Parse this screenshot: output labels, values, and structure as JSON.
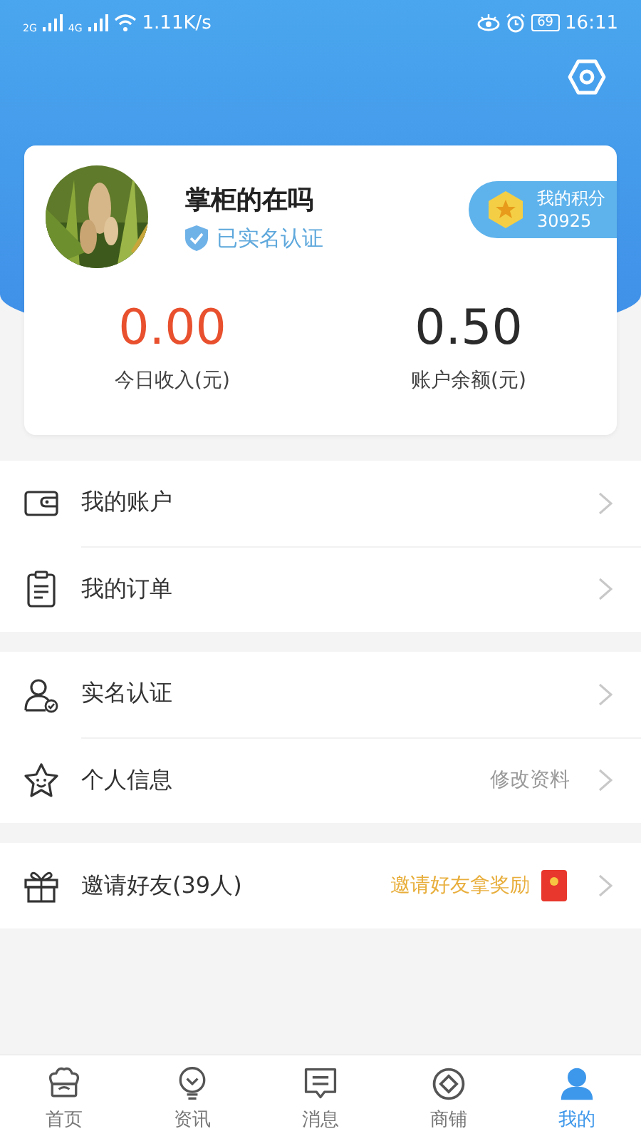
{
  "status_bar": {
    "network_1": "2G",
    "network_2": "4G",
    "speed": "1.11K/s",
    "battery": "69",
    "time": "16:11"
  },
  "profile": {
    "name": "掌柜的在吗",
    "verified": "已实名认证",
    "points_label": "我的积分",
    "points": "30925"
  },
  "stats": [
    {
      "value": "0.00",
      "label": "今日收入(元)",
      "kind": "income"
    },
    {
      "value": "0.50",
      "label": "账户余额(元)",
      "kind": "balance"
    }
  ],
  "menu_groups": [
    [
      {
        "label": "我的账户",
        "kind": "plain"
      },
      {
        "label": "我的订单",
        "kind": "plain"
      }
    ],
    [
      {
        "label": "实名认证",
        "kind": "plain"
      },
      {
        "label": "个人信息",
        "kind": "hint",
        "hint": "修改资料"
      }
    ],
    [
      {
        "label": "邀请好友(39人)",
        "kind": "reward",
        "hint": "邀请好友拿奖励"
      }
    ]
  ],
  "tabs": [
    {
      "label": "首页",
      "selected": false
    },
    {
      "label": "资讯",
      "selected": false
    },
    {
      "label": "消息",
      "selected": false
    },
    {
      "label": "商铺",
      "selected": false
    },
    {
      "label": "我的",
      "selected": true
    }
  ]
}
